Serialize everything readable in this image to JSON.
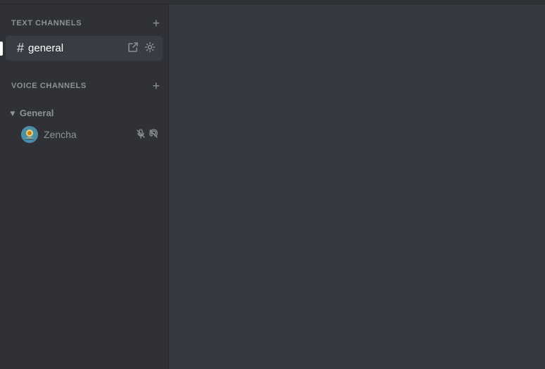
{
  "topBar": {
    "height": 6
  },
  "sidebar": {
    "textChannels": {
      "label": "TEXT CHANNELS",
      "addIcon": "+"
    },
    "channels": [
      {
        "name": "general",
        "active": true,
        "hash": "#"
      }
    ],
    "voiceChannels": {
      "label": "VOICE CHANNELS",
      "addIcon": "+"
    },
    "voiceCategories": [
      {
        "name": "General",
        "expanded": true,
        "users": [
          {
            "name": "Zencha",
            "muteIcon": "🔇",
            "deafIcon": "🎧"
          }
        ]
      }
    ]
  },
  "icons": {
    "chevronDown": "▼",
    "chevronRight": "▶",
    "hash": "#",
    "leave": "↗",
    "settings": "⚙",
    "mute": "🔕",
    "deafen": "🎧",
    "plus": "+"
  }
}
